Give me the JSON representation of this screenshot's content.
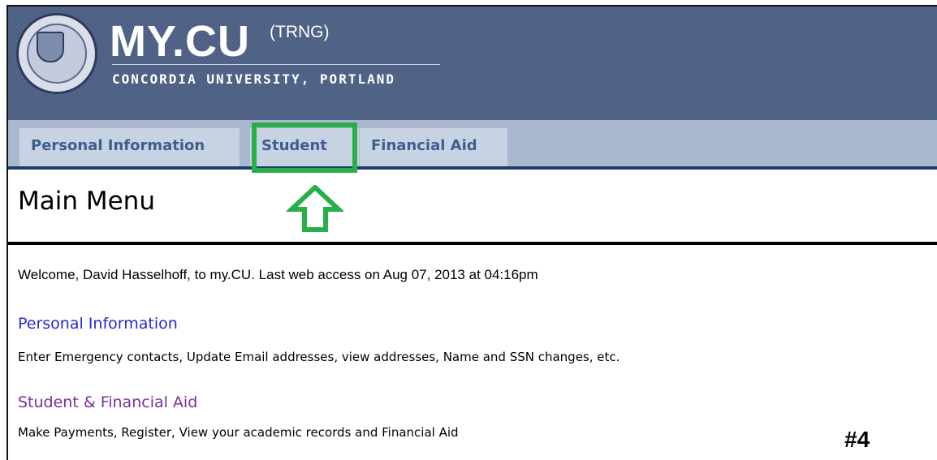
{
  "header": {
    "title": "MY.CU",
    "environment": "(TRNG)",
    "subtitle": "CONCORDIA UNIVERSITY, PORTLAND",
    "logo_icon": "university-seal-icon"
  },
  "tabs": [
    {
      "label": "Personal Information"
    },
    {
      "label": "Student",
      "highlighted": true
    },
    {
      "label": "Financial Aid"
    }
  ],
  "main": {
    "title": "Main Menu",
    "welcome": "Welcome, David Hasselhoff, to my.CU. Last web access on Aug 07, 2013 at 04:16pm",
    "sections": [
      {
        "link": "Personal Information",
        "description": "Enter Emergency contacts, Update Email addresses, view addresses, Name and SSN changes, etc."
      },
      {
        "link": "Student & Financial Aid",
        "description": "Make Payments, Register, View your academic records and Financial Aid"
      }
    ]
  },
  "annotation": {
    "step_label": "#4",
    "highlight_color": "#27b04a",
    "arrow_icon": "up-arrow-icon"
  },
  "colors": {
    "header_bg": "#4f6287",
    "tabbar_bg": "#a9b8cf",
    "tab_text": "#3c5f8e",
    "link_unvisited": "#2a27d3",
    "link_visited": "#7c2f9e"
  }
}
